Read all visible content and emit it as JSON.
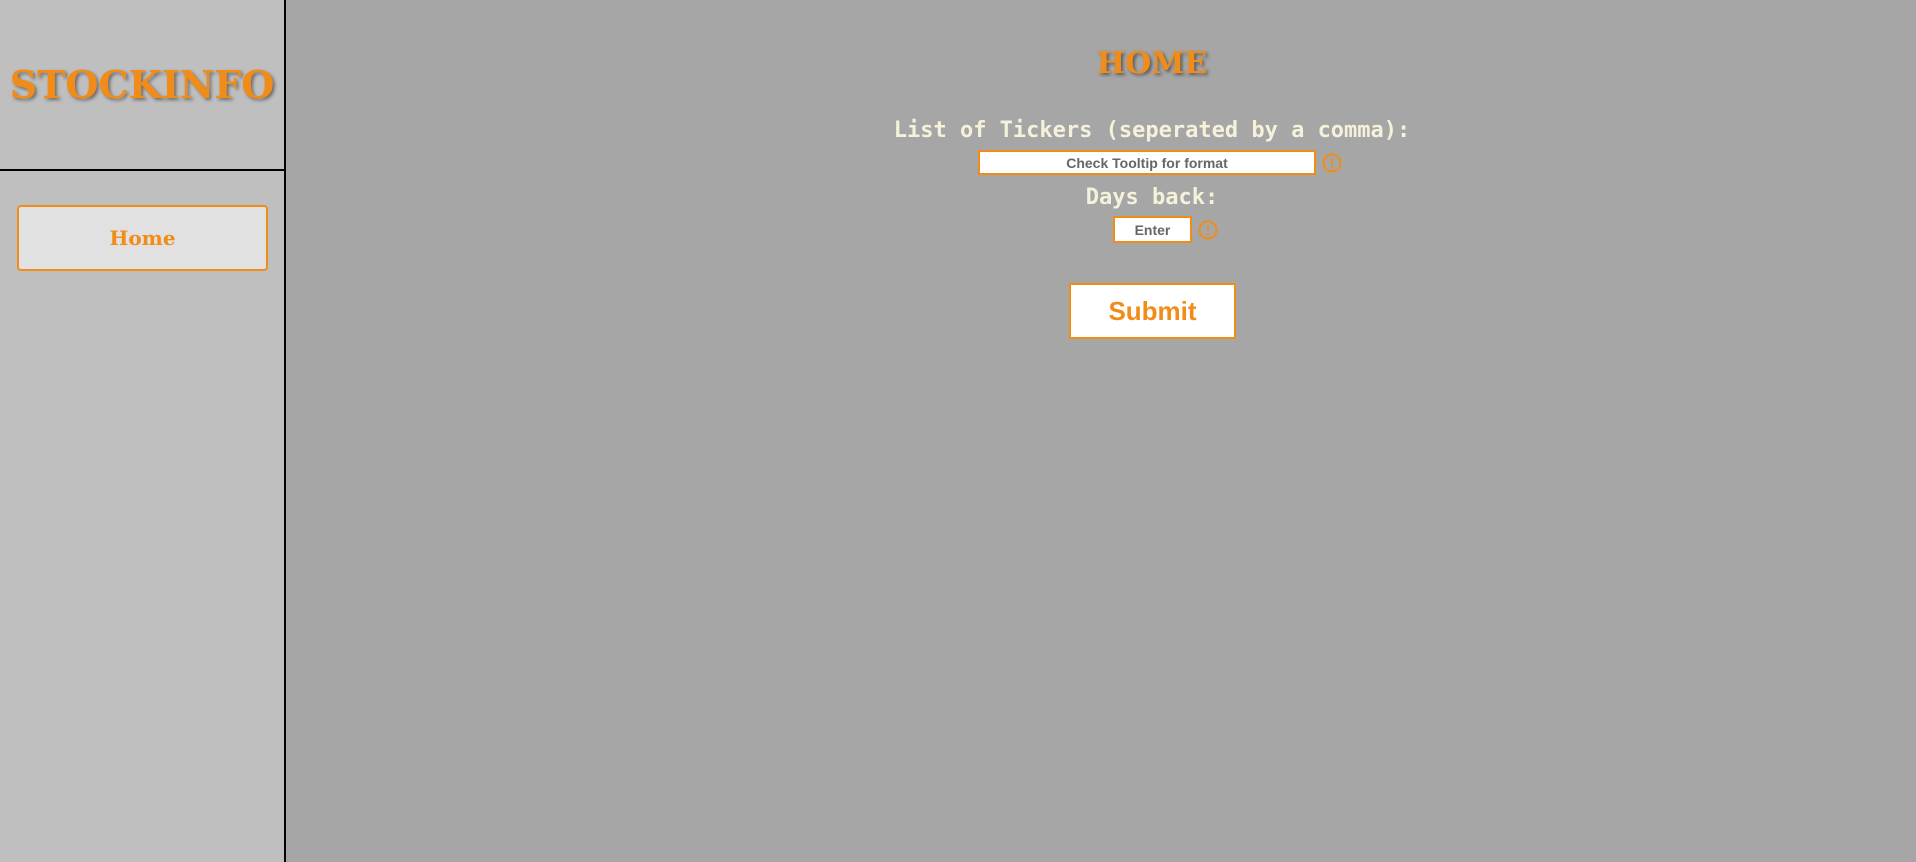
{
  "sidebar": {
    "brand": "STOCKINFO",
    "nav": {
      "home_label": "Home"
    }
  },
  "main": {
    "title": "HOME",
    "tickers": {
      "label": "List of Tickers (seperated by a comma):",
      "placeholder": "Check Tooltip for format",
      "value": ""
    },
    "days_back": {
      "label": "Days back:",
      "placeholder": "Enter",
      "value": ""
    },
    "submit_label": "Submit"
  },
  "icons": {
    "tickers_info": "info-icon",
    "days_info": "info-icon"
  },
  "colors": {
    "accent": "#f28c18",
    "main_background": "#a6a6a6",
    "sidebar_background": "#bfbfbf",
    "label_text": "#f6f1da"
  }
}
